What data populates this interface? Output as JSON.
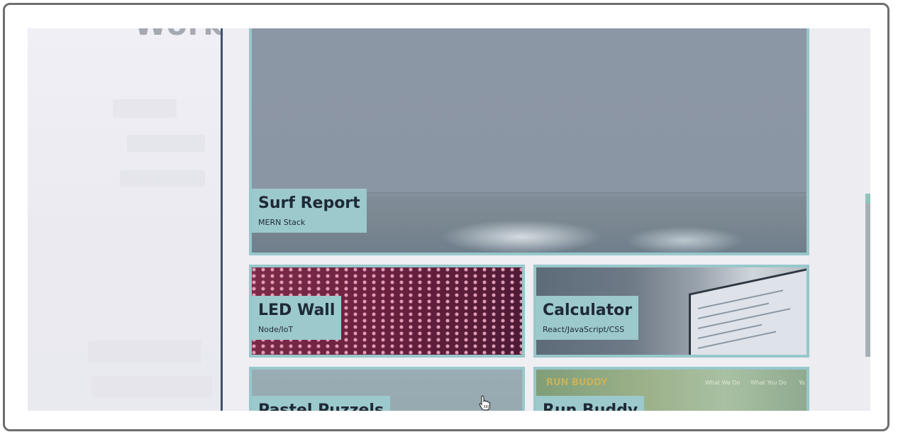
{
  "page": {
    "left_heading": "Work"
  },
  "projects": [
    {
      "title": "Surf Report",
      "stack": "MERN Stack"
    },
    {
      "title": "LED Wall",
      "stack": "Node/IoT"
    },
    {
      "title": "Calculator",
      "stack": "React/JavaScript/CSS"
    },
    {
      "title": "Pastel Puzzels",
      "stack": ""
    },
    {
      "title": "Run Buddy",
      "stack": ""
    }
  ],
  "run_buddy_preview": {
    "logo": "RUN BUDDY",
    "nav": [
      "What We Do",
      "What You Do",
      "Yo"
    ]
  },
  "colors": {
    "card_border": "#97c7cb",
    "label_bg": "#9cc9cc",
    "divider": "#3e5170"
  },
  "icons": [
    "hand-pointer-icon"
  ]
}
